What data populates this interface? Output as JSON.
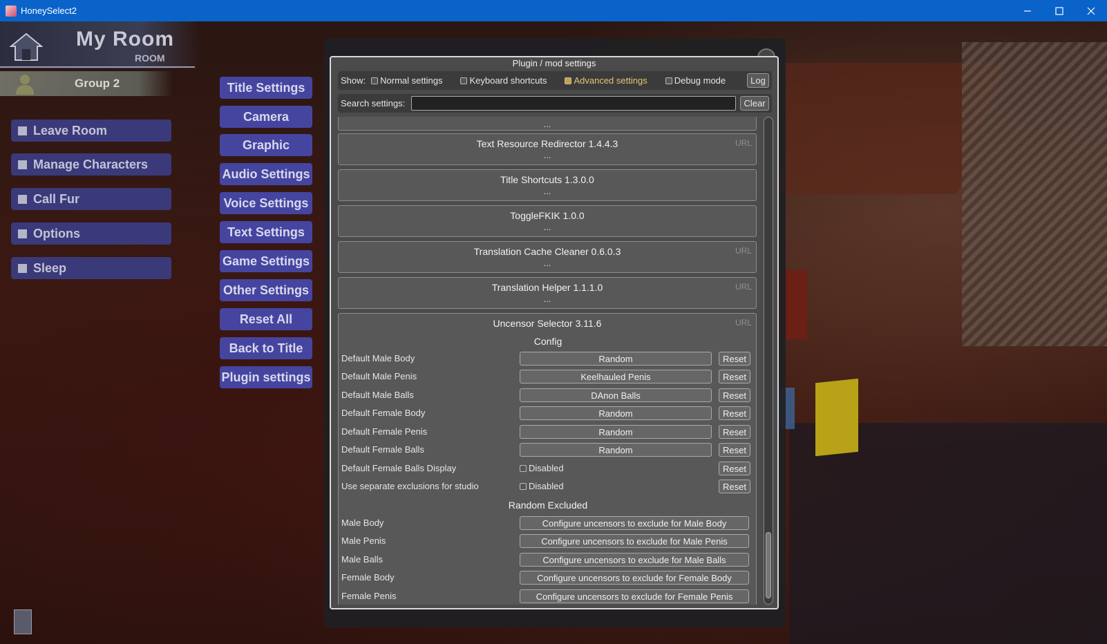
{
  "window": {
    "title": "HoneySelect2"
  },
  "hud": {
    "room_title": "My Room",
    "room_subtitle": "ROOM",
    "group": "Group 2",
    "menu": [
      "Leave Room",
      "Manage Characters",
      "Call Fur",
      "Options",
      "Sleep"
    ]
  },
  "options_menu": [
    "Title Settings",
    "Camera",
    "Graphic",
    "Audio Settings",
    "Voice Settings",
    "Text Settings",
    "Game Settings",
    "Other Settings",
    "Reset All",
    "Back to Title",
    "Plugin settings"
  ],
  "dialog": {
    "title": "Plugin / mod settings",
    "show_label": "Show:",
    "filters": [
      {
        "label": "Normal settings",
        "active": false
      },
      {
        "label": "Keyboard shortcuts",
        "active": false
      },
      {
        "label": "Advanced settings",
        "active": true
      },
      {
        "label": "Debug mode",
        "active": false
      }
    ],
    "log_label": "Log",
    "search_label": "Search settings:",
    "search_value": "",
    "clear_label": "Clear",
    "top_dots": "...",
    "plugins": [
      {
        "name": "Text Resource Redirector 1.4.4.3",
        "dots": "...",
        "url": "URL"
      },
      {
        "name": "Title Shortcuts 1.3.0.0",
        "dots": "...",
        "url": ""
      },
      {
        "name": "ToggleFKIK 1.0.0",
        "dots": "...",
        "url": ""
      },
      {
        "name": "Translation Cache Cleaner 0.6.0.3",
        "dots": "...",
        "url": "URL"
      },
      {
        "name": "Translation Helper 1.1.1.0",
        "dots": "...",
        "url": "URL"
      }
    ],
    "expanded": {
      "name": "Uncensor Selector 3.11.6",
      "url": "URL",
      "config_title": "Config",
      "reset_label": "Reset",
      "config": [
        {
          "label": "Default Male Body",
          "value": "Random"
        },
        {
          "label": "Default Male Penis",
          "value": "Keelhauled Penis"
        },
        {
          "label": "Default Male Balls",
          "value": "DAnon Balls"
        },
        {
          "label": "Default Female Body",
          "value": "Random"
        },
        {
          "label": "Default Female Penis",
          "value": "Random"
        },
        {
          "label": "Default Female Balls",
          "value": "Random"
        }
      ],
      "toggles": [
        {
          "label": "Default Female Balls Display",
          "value": "Disabled"
        },
        {
          "label": "Use separate exclusions for studio",
          "value": "Disabled"
        }
      ],
      "excluded_title": "Random Excluded",
      "excluded": [
        {
          "label": "Male Body",
          "button": "Configure uncensors to exclude for Male Body"
        },
        {
          "label": "Male Penis",
          "button": "Configure uncensors to exclude for Male Penis"
        },
        {
          "label": "Male Balls",
          "button": "Configure uncensors to exclude for Male Balls"
        },
        {
          "label": "Female Body",
          "button": "Configure uncensors to exclude for Female Body"
        },
        {
          "label": "Female Penis",
          "button": "Configure uncensors to exclude for Female Penis"
        }
      ]
    }
  },
  "colors": {
    "titlebar": "#0a63c9",
    "menu_button": "#3a3a7a",
    "options_button": "#4545a0",
    "dialog_bg": "#4b4b4b",
    "active_filter": "#e2c57a"
  }
}
